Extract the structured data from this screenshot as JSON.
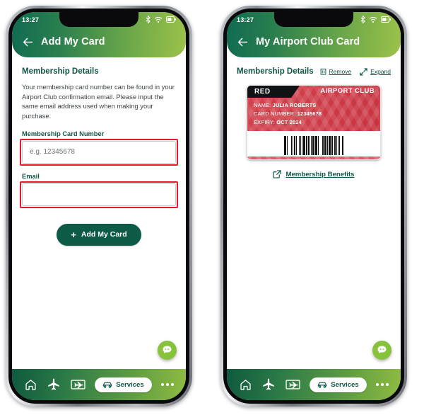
{
  "status_bar": {
    "time": "13:27",
    "icons": [
      "bluetooth-icon",
      "wifi-icon",
      "battery-icon"
    ]
  },
  "colors": {
    "brand_dark_green": "#0f5546",
    "brand_light_green": "#9cc24a",
    "fab_green": "#86c23a",
    "annotation_red": "#e8192c",
    "card_red": "#d2414c",
    "card_tag_black": "#111214"
  },
  "screens": [
    {
      "id": "add-my-card",
      "header": {
        "back_icon": "arrow-left-icon",
        "title": "Add My Card"
      },
      "section": {
        "title": "Membership Details",
        "paragraph": "Your membership card number can be found in your Airport Club confirmation email. Please input the same email address used when making your purchase."
      },
      "fields": [
        {
          "label": "Membership Card Number",
          "value": "",
          "placeholder": "e.g. 12345678",
          "highlighted": true
        },
        {
          "label": "Email",
          "value": "",
          "placeholder": "",
          "highlighted": true
        }
      ],
      "submit": {
        "icon": "plus-icon",
        "label": "Add My Card"
      }
    },
    {
      "id": "my-airport-club-card",
      "header": {
        "back_icon": "arrow-left-icon",
        "title": "My Airport Club Card"
      },
      "section": {
        "title": "Membership Details"
      },
      "actions": [
        {
          "icon": "trash-icon",
          "label": "Remove"
        },
        {
          "icon": "expand-icon",
          "label": "Expand"
        }
      ],
      "card": {
        "tier": "RED",
        "club": "AIRPORT CLUB",
        "rows": [
          {
            "label": "NAME:",
            "value": "JULIA ROBERTS"
          },
          {
            "label": "CARD NUMBER:",
            "value": "12345678"
          },
          {
            "label": "EXPIRY:",
            "value": "OCT 2024"
          }
        ],
        "barcode_pattern": [
          3,
          1,
          1,
          2,
          1,
          3,
          1,
          1,
          1,
          2,
          2,
          1,
          3,
          1,
          1,
          1,
          2,
          1,
          1,
          3,
          1,
          2,
          1,
          1,
          3,
          1,
          1,
          2,
          1,
          1,
          3,
          2,
          1,
          1,
          1,
          2,
          3,
          1,
          1,
          1,
          2,
          1,
          3,
          1,
          1,
          2,
          1,
          1,
          2,
          3,
          1,
          1,
          1,
          2,
          1,
          3,
          1,
          1,
          2,
          1,
          1,
          1,
          3,
          2,
          1,
          1,
          2,
          1,
          3,
          1,
          1,
          1,
          2,
          3,
          1,
          1,
          1,
          2,
          1,
          1,
          3,
          1,
          2,
          1,
          1,
          2,
          3,
          1
        ]
      },
      "benefits_link": {
        "icon": "external-link-icon",
        "label": "Membership Benefits"
      }
    }
  ],
  "fab": {
    "icon": "chat-bubble-icon"
  },
  "bottom_nav": {
    "items": [
      {
        "icon": "home-icon",
        "label": ""
      },
      {
        "icon": "airplane-icon",
        "label": ""
      },
      {
        "icon": "boarding-pass-icon",
        "label": ""
      }
    ],
    "active_pill": {
      "icon": "car-icon",
      "label": "Services"
    },
    "more": {
      "icon": "ellipsis-icon",
      "label": ""
    }
  }
}
